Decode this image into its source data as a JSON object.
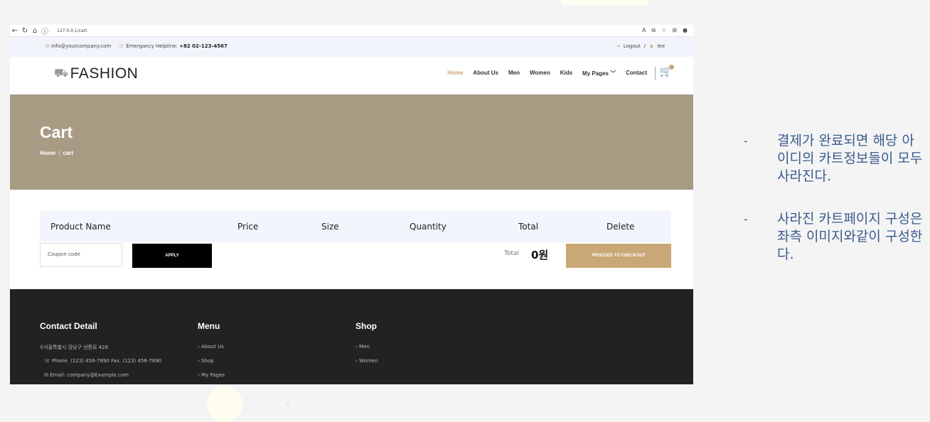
{
  "browser": {
    "url": "127.0.0.1/cart",
    "icons": [
      "back-icon",
      "refresh-icon",
      "home-icon",
      "info-icon"
    ],
    "right_icons": [
      "read-aloud-icon",
      "tab-icon",
      "favorites-icon",
      "collections-icon",
      "profile-icon"
    ]
  },
  "topbar": {
    "email": "info@yourcompany.com",
    "helpline_label": "Emergancy Helpline:",
    "helpline_number": "+82 02-123-4567",
    "logout": "Logout",
    "separator": "/",
    "user": "lee"
  },
  "header": {
    "logo": "FASHION",
    "menu": [
      "Home",
      "About Us",
      "Men",
      "Women",
      "Kids",
      "My Pages ﹀",
      "Contact"
    ]
  },
  "hero": {
    "title": "Cart",
    "crumb_home": "Home",
    "crumb_sep": "|",
    "crumb_current": "cart"
  },
  "table": {
    "headers": [
      "Product Name",
      "Price",
      "Size",
      "Quantity",
      "Total",
      "Delete"
    ]
  },
  "coupon": {
    "placeholder": "Coupon code",
    "apply": "APPLY"
  },
  "summary": {
    "total_label": "Total",
    "total_value": "0원",
    "checkout": "PROCEED TO CHECKOUT"
  },
  "footer": {
    "contact": {
      "title": "Contact Detail",
      "address": "서울특별시 강남구 선릉로 428",
      "phone_fax": "Phone. (123) 456-7890  Fax. (123) 456-7890",
      "email": "Email: company@Example.com"
    },
    "menu": {
      "title": "Menu",
      "items": [
        "About Us",
        "Shop",
        "My Pages"
      ]
    },
    "shop": {
      "title": "Shop",
      "items": [
        "Men",
        "Women"
      ]
    }
  },
  "notes": {
    "dash": "-",
    "note1": "결제가 완료되면 해당 아이디의 카트정보들이 모두 사라진다.",
    "note2": "사라진 카트페이지 구성은 좌측 이미지와같이 구성한다."
  },
  "colors": {
    "accent": "#c9a776",
    "hero_bg": "#a89b84",
    "footer_bg": "#222222",
    "note_text": "#3a5a8c"
  }
}
